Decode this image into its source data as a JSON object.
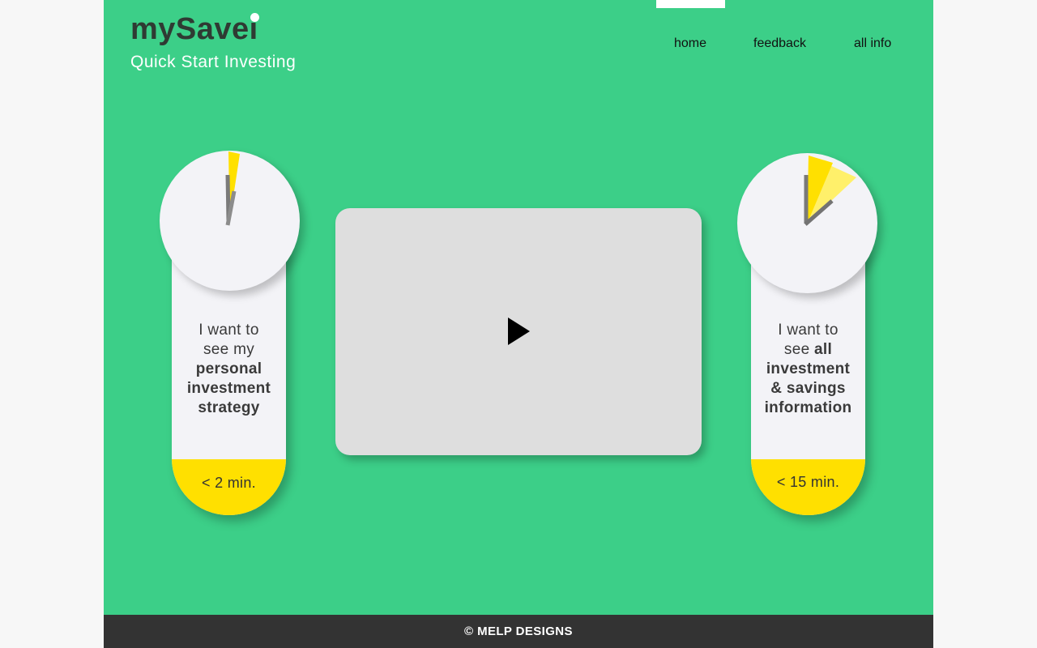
{
  "brand": {
    "name": "mySavei",
    "tagline": "Quick Start Investing"
  },
  "nav": {
    "items": [
      "home",
      "feedback",
      "all info"
    ],
    "active": "home"
  },
  "cards": [
    {
      "line1": "I want to",
      "line2": "see my",
      "bold": [
        "personal",
        "investment",
        "strategy"
      ],
      "time": "< 2 min."
    },
    {
      "line1": "I want to",
      "line2_prefix": "see",
      "line2_bold": "all",
      "bold": [
        "investment",
        "& savings",
        "information"
      ],
      "time": "< 15 min."
    }
  ],
  "video": {
    "icon": "play-icon"
  },
  "footer": {
    "text": "© MELP DESIGNS"
  },
  "colors": {
    "background": "#3ccf88",
    "accent": "#ffe000",
    "accent_light": "#fff06a",
    "card": "#f3f3f7",
    "footer": "#333333",
    "text_dark": "#2f3a33"
  }
}
